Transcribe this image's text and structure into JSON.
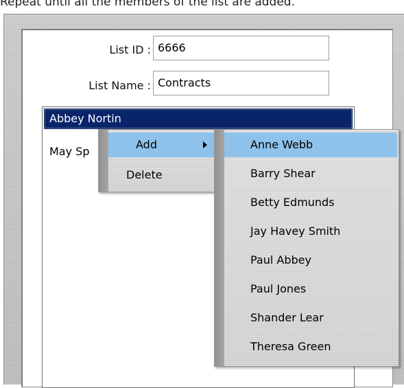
{
  "caption": "Repeat until all the members of the list are added.",
  "form": {
    "list_id_label": "List ID :",
    "list_id_value": "6666",
    "list_name_label": "List Name :",
    "list_name_value": "Contracts"
  },
  "list": {
    "items": [
      {
        "label": "Abbey Nortin",
        "selected": true
      },
      {
        "label": "May Sp",
        "selected": false
      }
    ]
  },
  "context_menu": {
    "items": [
      {
        "label": "Add",
        "has_submenu": true,
        "highlighted": true
      },
      {
        "label": "Delete",
        "has_submenu": false,
        "highlighted": false
      }
    ]
  },
  "submenu": {
    "items": [
      {
        "label": "Anne Webb",
        "highlighted": true
      },
      {
        "label": "Barry Shear"
      },
      {
        "label": "Betty Edmunds"
      },
      {
        "label": "Jay Havey Smith"
      },
      {
        "label": "Paul Abbey"
      },
      {
        "label": "Paul Jones"
      },
      {
        "label": "Shander Lear"
      },
      {
        "label": "Theresa Green"
      }
    ]
  },
  "colors": {
    "selection": "#0a246a",
    "menu_highlight": "#8ec2ea",
    "frame": "#c2c2c2"
  },
  "icons": {
    "submenu_indicator": "triangle-right-icon"
  }
}
